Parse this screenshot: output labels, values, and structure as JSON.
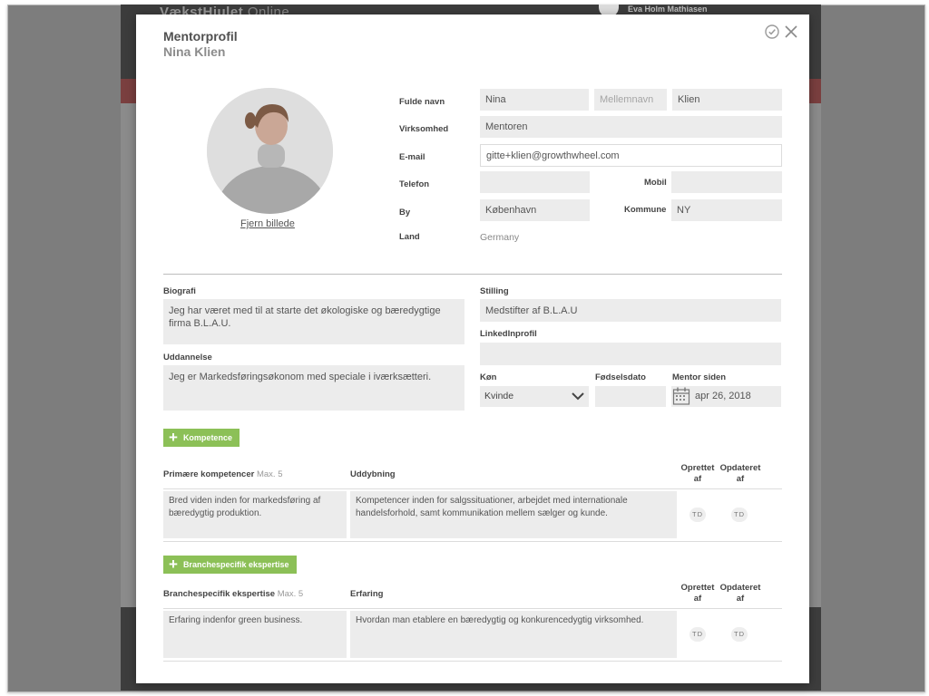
{
  "background": {
    "brand": "VækstHjulet",
    "brand_suffix": "Online",
    "user_name": "Eva Holm Mathiasen"
  },
  "modal": {
    "title": "Mentorprofil",
    "subtitle": "Nina Klien",
    "remove_photo": "Fjern billede"
  },
  "form": {
    "labels": {
      "full_name": "Fulde navn",
      "company": "Virksomhed",
      "email": "E-mail",
      "phone": "Telefon",
      "mobile": "Mobil",
      "city": "By",
      "municipality": "Kommune",
      "country": "Land",
      "biography": "Biografi",
      "position": "Stilling",
      "linkedin": "LinkedInprofil",
      "education": "Uddannelse",
      "gender": "Køn",
      "birthdate": "Fødselsdato",
      "mentor_since": "Mentor siden"
    },
    "values": {
      "first_name": "Nina",
      "middle_name": "",
      "last_name": "Klien",
      "company": "Mentoren",
      "email": "gitte+klien@growthwheel.com",
      "phone": "",
      "mobile": "",
      "city": "København",
      "municipality": "NY",
      "country": "Germany",
      "biography": "Jeg har været med til at starte det økologiske og bæredygtige firma B.L.A.U.",
      "position": "Medstifter af B.L.A.U",
      "linkedin": "",
      "education": "Jeg er Markedsføringsøkonom med speciale i iværksætteri.",
      "gender": "Kvinde",
      "birthdate": "",
      "mentor_since": "apr 26, 2018"
    },
    "placeholders": {
      "middle_name": "Mellemnavn"
    }
  },
  "competence": {
    "add_button": "Kompetence",
    "col_primary": "Primære kompetencer",
    "col_primary_max": "Max. 5",
    "col_detail": "Uddybning",
    "col_created": "Oprettet af",
    "col_updated": "Opdateret af",
    "rows": [
      {
        "competence": "Bred viden inden for markedsføring af bæredygtig produktion.",
        "detail": "Kompetencer inden for salgssituationer, arbejdet med internationale handelsforhold, samt kommunikation mellem sælger og kunde.",
        "created_by": "TD",
        "updated_by": "TD"
      }
    ]
  },
  "expertise": {
    "add_button": "Branchespecifik ekspertise",
    "col_primary": "Branchespecifik ekspertise",
    "col_primary_max": "Max. 5",
    "col_detail": "Erfaring",
    "col_created": "Oprettet af",
    "col_updated": "Opdateret af",
    "rows": [
      {
        "expertise": "Erfaring indenfor green business.",
        "detail": "Hvordan man etablere en bæredygtig og konkurencedygtig virksomhed.",
        "created_by": "TD",
        "updated_by": "TD"
      }
    ]
  },
  "colors": {
    "accent_green": "#8cc057",
    "field_bg": "#ececec",
    "overlay": "#7d7d7d"
  }
}
